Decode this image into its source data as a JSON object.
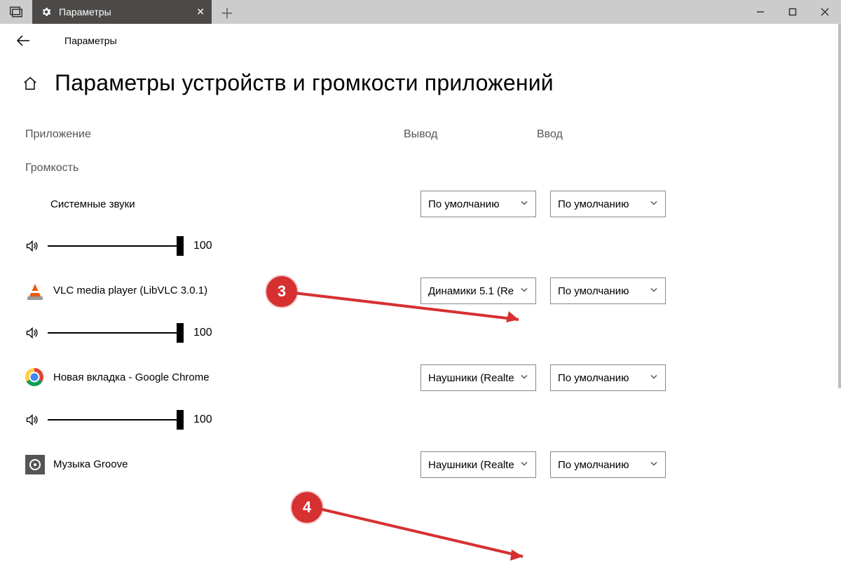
{
  "titlebar": {
    "tab_title": "Параметры"
  },
  "subheader": {
    "breadcrumb": "Параметры"
  },
  "page": {
    "title": "Параметры устройств и громкости приложений"
  },
  "columns": {
    "app": "Приложение",
    "output": "Вывод",
    "input": "Ввод"
  },
  "subhead": {
    "volume": "Громкость"
  },
  "rows": {
    "system": {
      "label": "Системные звуки",
      "output": "По умолчанию",
      "input": "По умолчанию",
      "volume": "100"
    },
    "vlc": {
      "label": "VLC media player (LibVLC 3.0.1)",
      "output": "Динамики 5.1 (Re",
      "input": "По умолчанию",
      "volume": "100"
    },
    "chrome": {
      "label": "Новая вкладка - Google Chrome",
      "output": "Наушники (Realte",
      "input": "По умолчанию",
      "volume": "100"
    },
    "groove": {
      "label": "Музыка Groove",
      "output": "Наушники (Realte",
      "input": "По умолчанию"
    }
  },
  "annotations": {
    "a3": "3",
    "a4": "4"
  }
}
